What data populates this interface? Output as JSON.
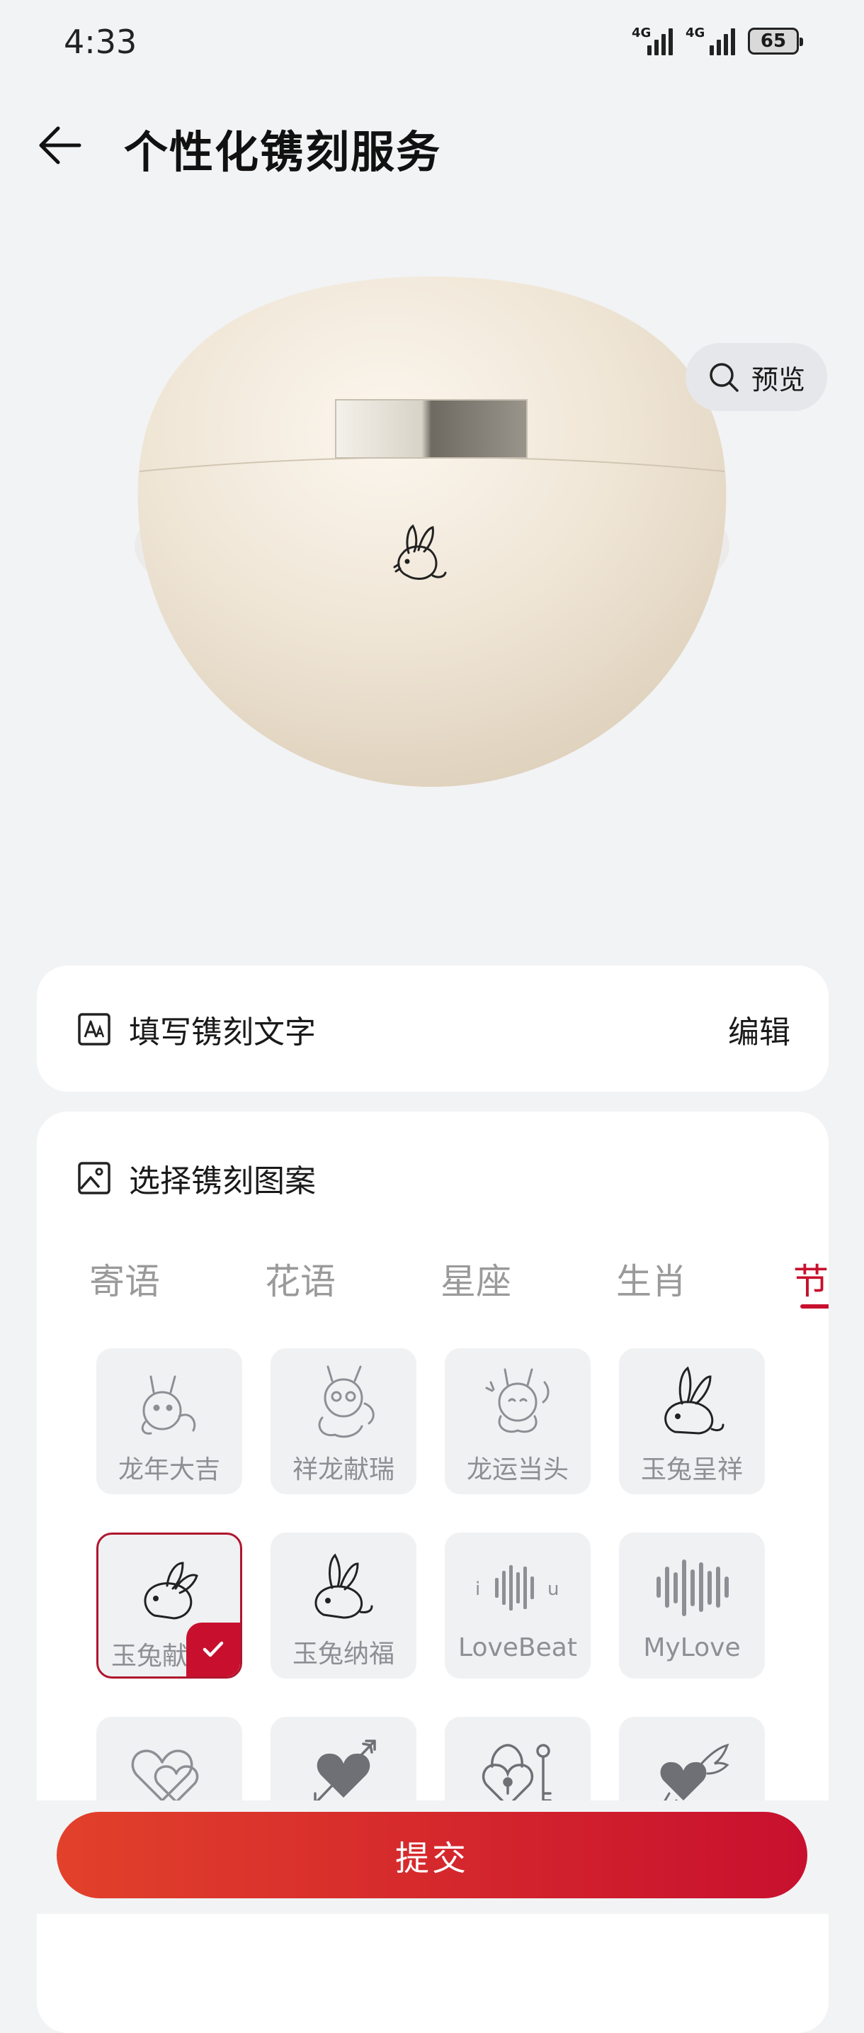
{
  "status_bar": {
    "time": "4:33",
    "signal1": "4G",
    "signal2": "4G",
    "battery": "65"
  },
  "header": {
    "title": "个性化镌刻服务"
  },
  "preview": {
    "label": "预览"
  },
  "text_card": {
    "label": "填写镌刻文字",
    "action": "编辑"
  },
  "pattern_card": {
    "label": "选择镌刻图案",
    "tabs": [
      "寄语",
      "花语",
      "星座",
      "生肖",
      "节"
    ],
    "active_tab": "节",
    "items": [
      {
        "name": "龙年大吉",
        "icon": "dragon-icon"
      },
      {
        "name": "祥龙献瑞",
        "icon": "dragon-icon"
      },
      {
        "name": "龙运当头",
        "icon": "dragon-icon"
      },
      {
        "name": "玉兔呈祥",
        "icon": "rabbit-icon"
      },
      {
        "name": "玉兔献",
        "icon": "rabbit-icon",
        "selected": true
      },
      {
        "name": "玉兔纳福",
        "icon": "rabbit-icon"
      },
      {
        "name": "LoveBeat",
        "icon": "soundwave-icon"
      },
      {
        "name": "MyLove",
        "icon": "soundwave-icon"
      },
      {
        "name": "",
        "icon": "double-heart-icon"
      },
      {
        "name": "",
        "icon": "heart-arrow-icon"
      },
      {
        "name": "",
        "icon": "heart-lock-key-icon"
      },
      {
        "name": "",
        "icon": "winged-heart-icon"
      }
    ]
  },
  "submit": {
    "label": "提交"
  },
  "colors": {
    "accent": "#c8102e",
    "background": "#f2f3f5",
    "case": "#efe6d6"
  }
}
